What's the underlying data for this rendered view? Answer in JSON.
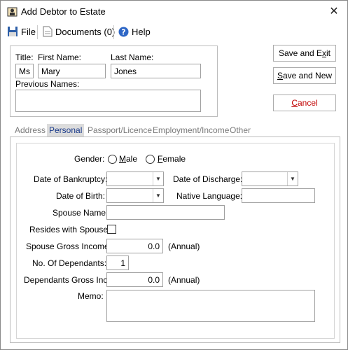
{
  "window": {
    "title": "Add Debtor to Estate",
    "close_glyph": "✕"
  },
  "toolbar": {
    "file": "File",
    "documents": "Documents (0)",
    "help": "Help"
  },
  "name": {
    "title_label": "Title:",
    "title_value": "Ms",
    "first_label": "First Name:",
    "first_value": "Mary",
    "last_label": "Last Name:",
    "last_value": "Jones",
    "prev_label": "Previous Names:",
    "prev_value": ""
  },
  "buttons": {
    "save_exit_pre": "Save and E",
    "save_exit_ul": "x",
    "save_exit_post": "it",
    "save_new_ul": "S",
    "save_new_post": "ave and New",
    "cancel_ul": "C",
    "cancel_post": "ancel"
  },
  "tabs": [
    "Address",
    "Personal",
    "Passport/Licence",
    "Employment/Income",
    "Other"
  ],
  "personal": {
    "gender_label": "Gender:",
    "male_ul": "M",
    "male_post": "ale",
    "female_ul": "F",
    "female_post": "emale",
    "bankruptcy_label": "Date of Bankruptcy:",
    "discharge_label": "Date of Discharge:",
    "dob_label": "Date of Birth:",
    "language_label": "Native Language:",
    "spouse_label": "Spouse Name:",
    "resides_label": "Resides with Spouse:",
    "income_label": "Spouse Gross Income:",
    "income_value": "0.0",
    "income_suffix": "(Annual)",
    "dependants_label": "No. Of Dependants:",
    "dependants_value": "1",
    "dep_income_label": "Dependants Gross Inc:",
    "dep_income_value": "0.0",
    "dep_income_suffix": "(Annual)",
    "memo_label": "Memo:"
  },
  "colors": {
    "cancel_text": "#c00000",
    "active_tab_bg": "#dcdcdc",
    "active_tab_text": "#1a3a8a"
  }
}
